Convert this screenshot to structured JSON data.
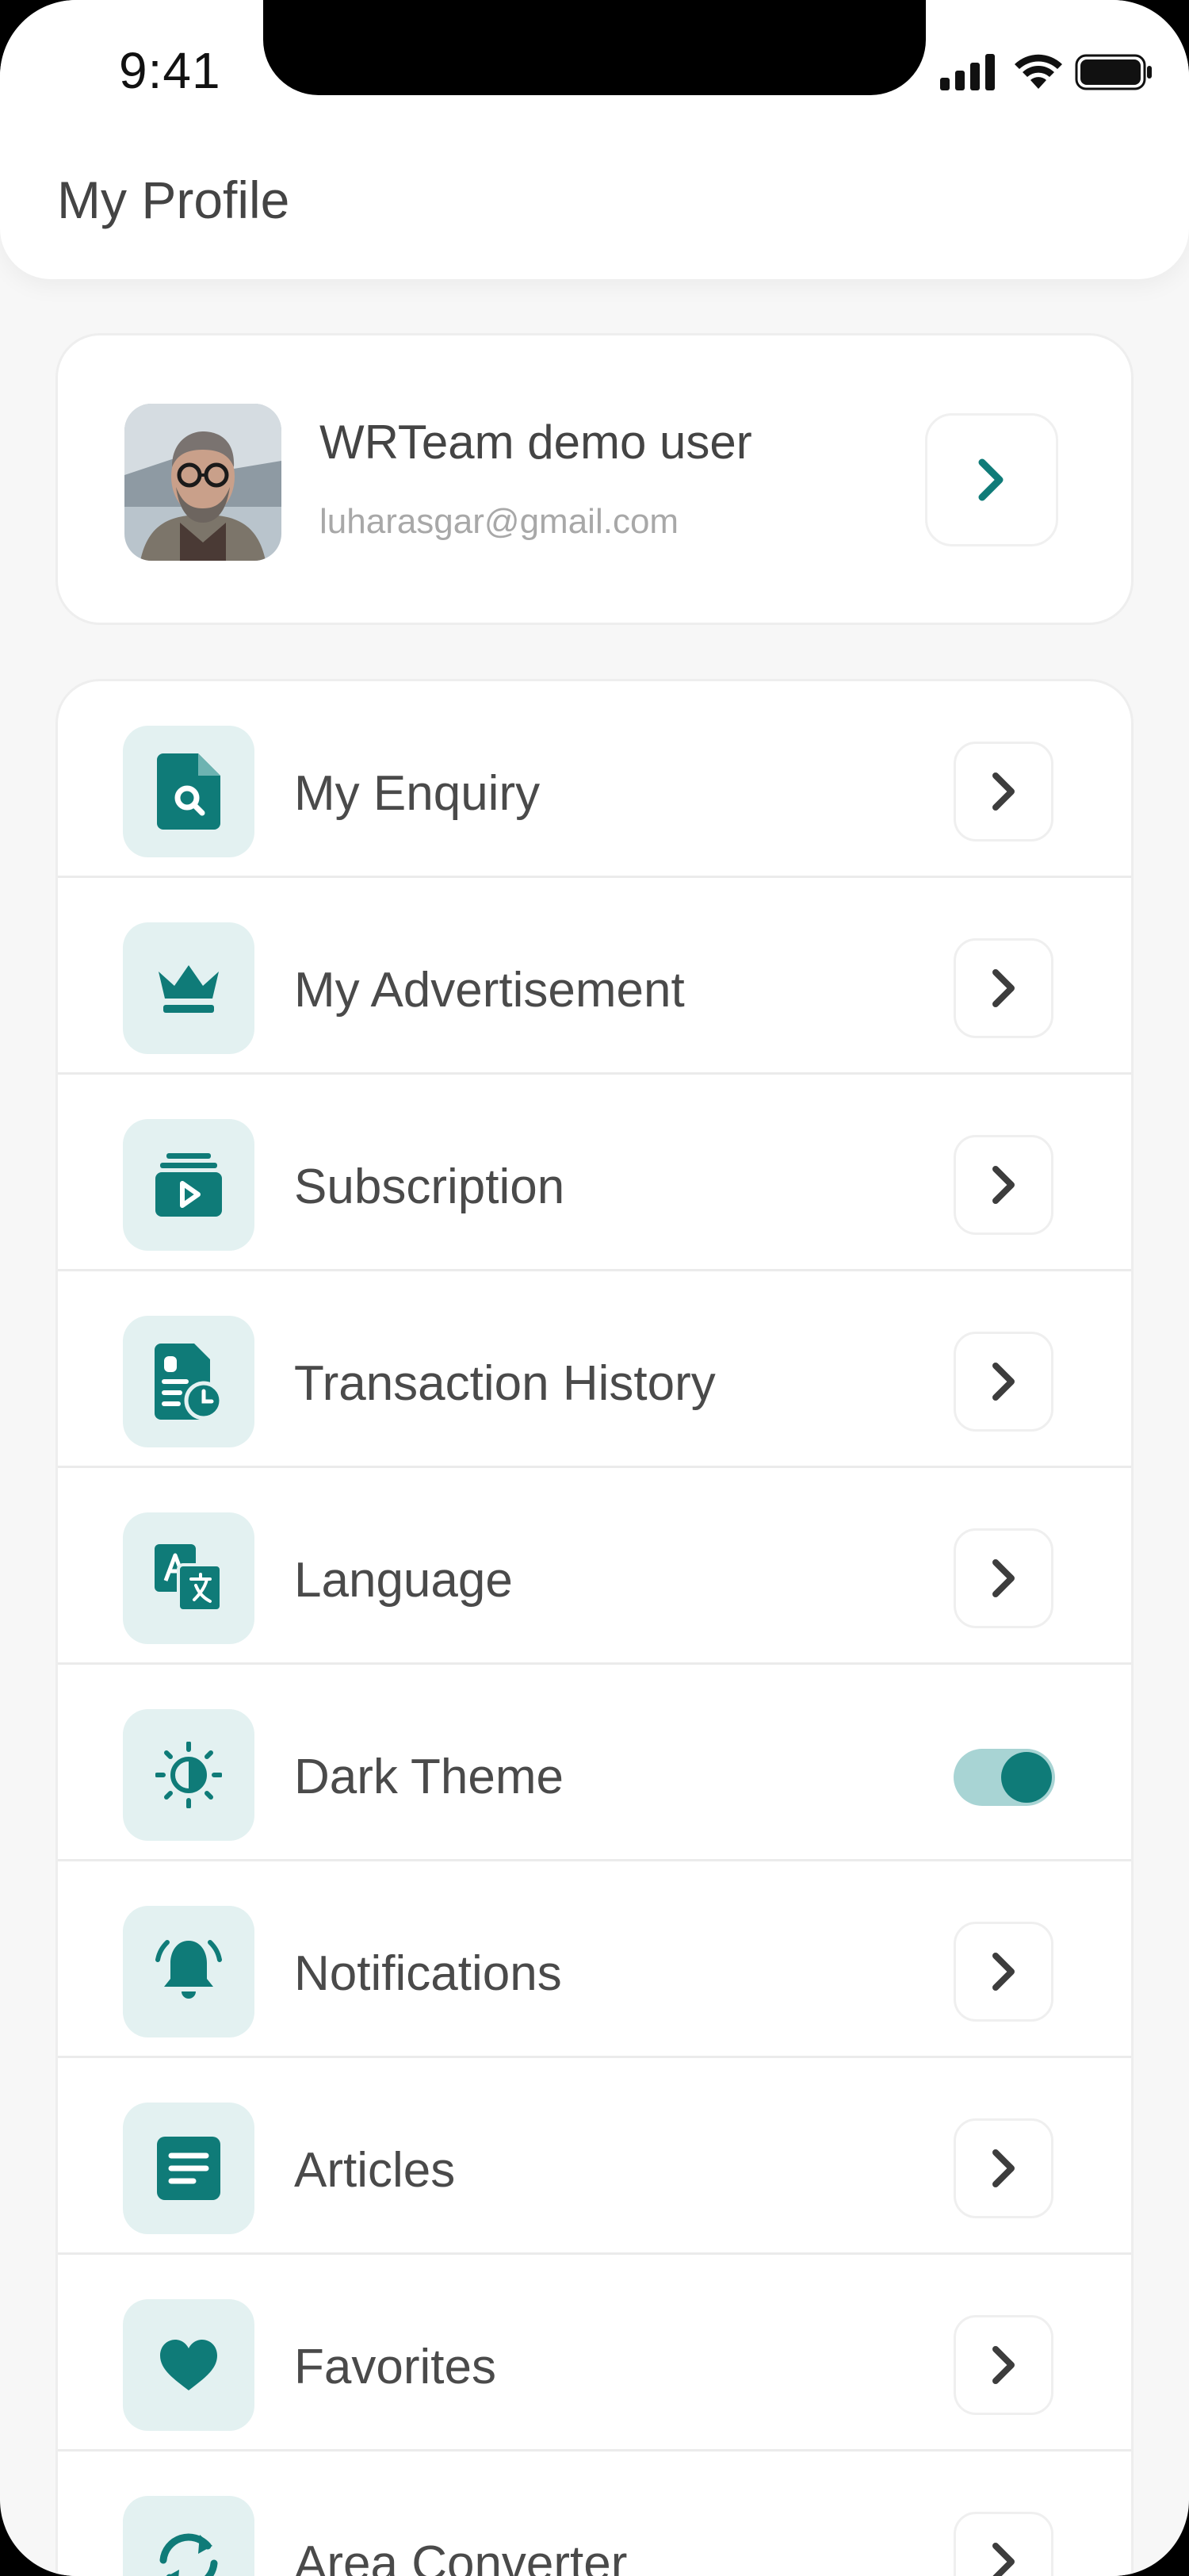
{
  "status_bar": {
    "time": "9:41"
  },
  "header": {
    "title": "My Profile"
  },
  "profile": {
    "name": "WRTeam demo user",
    "email": "luharasgar@gmail.com"
  },
  "menu": {
    "items": [
      {
        "label": "My Enquiry",
        "icon": "file-search-icon",
        "control": "chevron"
      },
      {
        "label": "My Advertisement",
        "icon": "crown-icon",
        "control": "chevron"
      },
      {
        "label": "Subscription",
        "icon": "subscription-play-icon",
        "control": "chevron"
      },
      {
        "label": "Transaction History",
        "icon": "document-clock-icon",
        "control": "chevron"
      },
      {
        "label": "Language",
        "icon": "translate-icon",
        "control": "chevron"
      },
      {
        "label": "Dark Theme",
        "icon": "theme-contrast-icon",
        "control": "toggle",
        "toggle_on": true
      },
      {
        "label": "Notifications",
        "icon": "bell-icon",
        "control": "chevron"
      },
      {
        "label": "Articles",
        "icon": "article-icon",
        "control": "chevron"
      },
      {
        "label": "Favorites",
        "icon": "heart-icon",
        "control": "chevron"
      },
      {
        "label": "Area Converter",
        "icon": "convert-icon",
        "control": "chevron"
      }
    ]
  },
  "colors": {
    "accent": "#0f7b78",
    "icon_bg": "#e3f1f1",
    "toggle_track": "#a8d4d4",
    "text": "#4a4a4a",
    "muted": "#a8a8a8"
  }
}
